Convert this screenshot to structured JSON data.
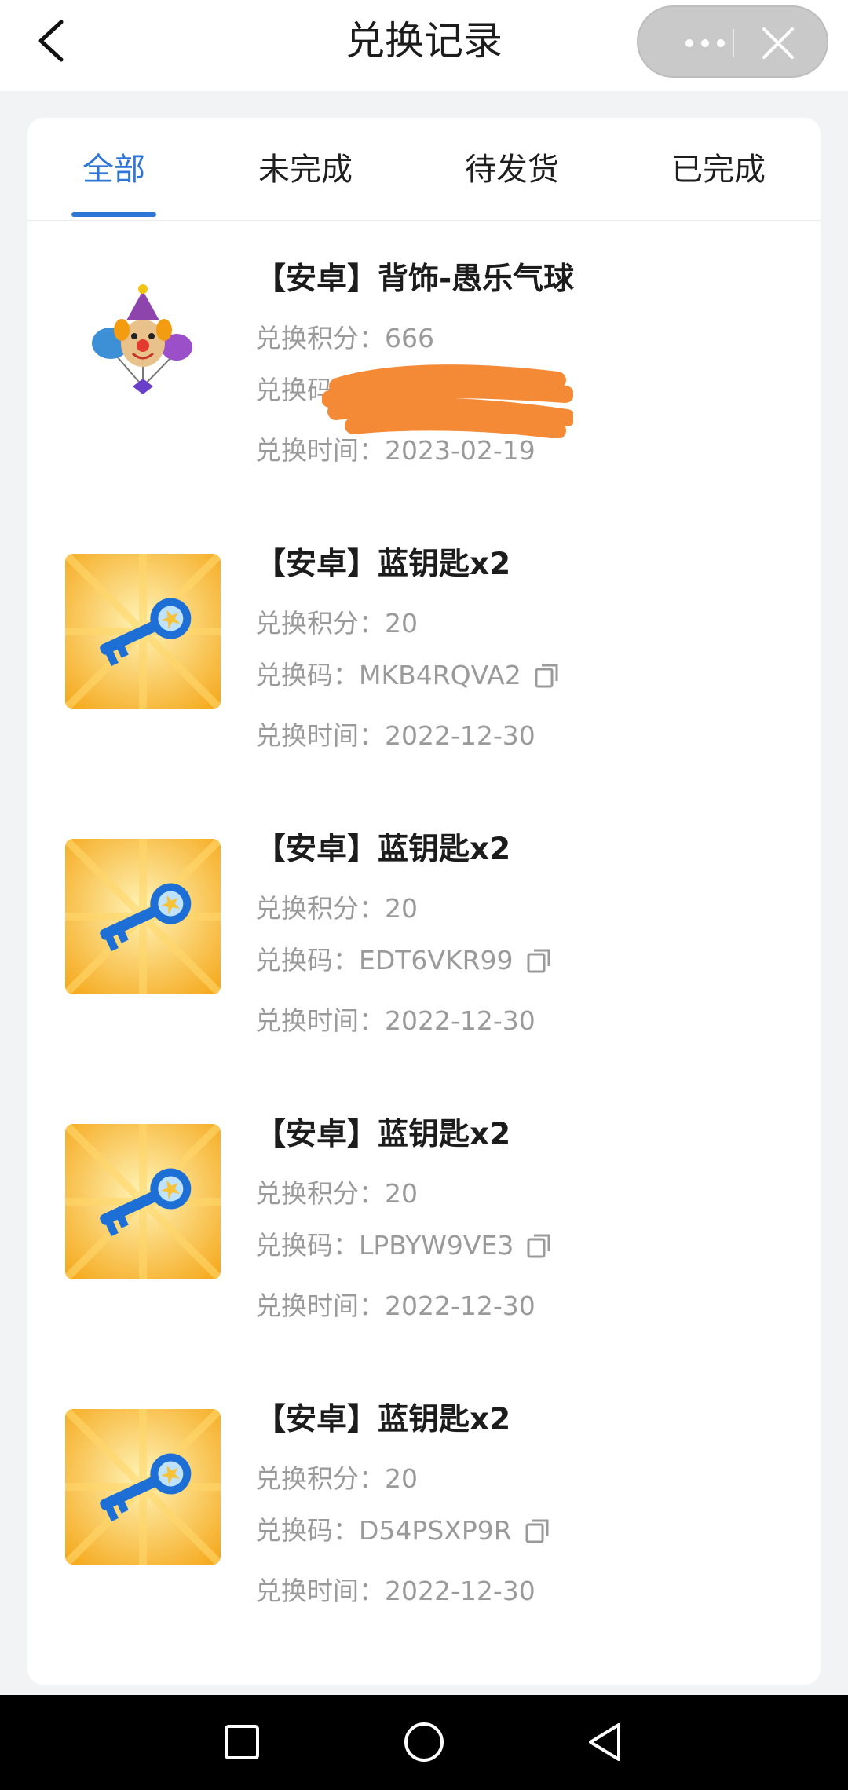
{
  "header": {
    "title": "兑换记录",
    "back_icon": "chevron-left-icon",
    "more_icon": "more-dots-icon",
    "close_icon": "close-icon"
  },
  "tabs": [
    {
      "label": "全部",
      "active": true
    },
    {
      "label": "未完成",
      "active": false
    },
    {
      "label": "待发货",
      "active": false
    },
    {
      "label": "已完成",
      "active": false
    }
  ],
  "labels": {
    "points": "兑换积分：",
    "code": "兑换码：",
    "time": "兑换时间："
  },
  "records": [
    {
      "title": "【安卓】背饰-愚乐气球",
      "points": "666",
      "code": "",
      "time": "2023-02-19",
      "image": "clown-balloon-image",
      "code_redacted": true
    },
    {
      "title": "【安卓】蓝钥匙x2",
      "points": "20",
      "code": "MKB4RQVA2",
      "time": "2022-12-30",
      "image": "blue-key-image"
    },
    {
      "title": "【安卓】蓝钥匙x2",
      "points": "20",
      "code": "EDT6VKR99",
      "time": "2022-12-30",
      "image": "blue-key-image"
    },
    {
      "title": "【安卓】蓝钥匙x2",
      "points": "20",
      "code": "LPBYW9VE3",
      "time": "2022-12-30",
      "image": "blue-key-image"
    },
    {
      "title": "【安卓】蓝钥匙x2",
      "points": "20",
      "code": "D54PSXP9R",
      "time": "2022-12-30",
      "image": "blue-key-image"
    }
  ],
  "navbar": {
    "recent_icon": "square-recents-icon",
    "home_icon": "circle-home-icon",
    "back_icon": "triangle-back-icon"
  },
  "colors": {
    "accent": "#2e75d6",
    "redaction": "#f58a36",
    "thumb_bg": "#f7b52b"
  }
}
